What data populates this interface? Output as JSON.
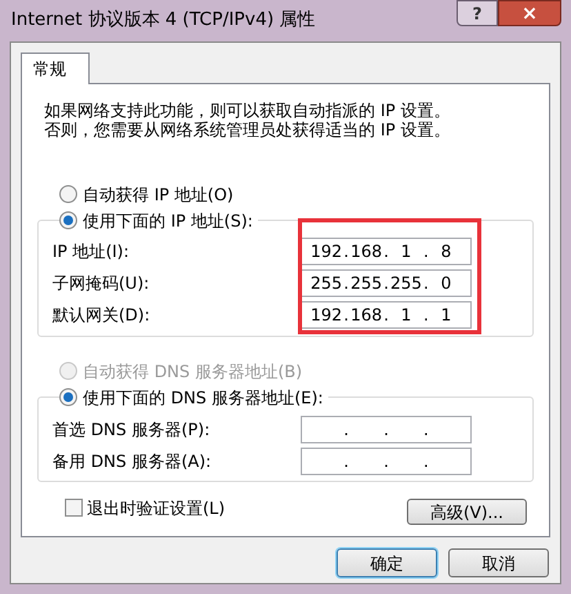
{
  "window": {
    "title": "Internet 协议版本 4 (TCP/IPv4) 属性",
    "help": "?",
    "close": "×"
  },
  "tabs": [
    {
      "label": "常规",
      "selected": true
    }
  ],
  "intro": "如果网络支持此功能，则可以获取自动指派的 IP 设置。否则，您需要从网络系统管理员处获得适当的 IP 设置。",
  "ip_mode": [
    {
      "label": "自动获得 IP 地址(O)",
      "selected": false,
      "disabled": false
    },
    {
      "label": "使用下面的 IP 地址(S):",
      "selected": true,
      "disabled": false
    }
  ],
  "ip_fields_highlighted": true,
  "ip_fields": [
    {
      "label": "IP 地址(I):",
      "separator": ".",
      "octets": [
        "192",
        "168",
        "1",
        "8"
      ]
    },
    {
      "label": "子网掩码(U):",
      "separator": ".",
      "octets": [
        "255",
        "255",
        "255",
        "0"
      ]
    },
    {
      "label": "默认网关(D):",
      "separator": ".",
      "octets": [
        "192",
        "168",
        "1",
        "1"
      ]
    }
  ],
  "dns_mode": [
    {
      "label": "自动获得 DNS 服务器地址(B)",
      "selected": false,
      "disabled": true
    },
    {
      "label": "使用下面的 DNS 服务器地址(E):",
      "selected": true,
      "disabled": false
    }
  ],
  "dns_fields": [
    {
      "label": "首选 DNS 服务器(P):",
      "separator": "."
    },
    {
      "label": "备用 DNS 服务器(A):",
      "separator": "."
    }
  ],
  "validate": {
    "label": "退出时验证设置(L)",
    "checked": false
  },
  "advanced_button": "高级(V)...",
  "buttons": [
    {
      "label": "确定",
      "default": true
    },
    {
      "label": "取消",
      "default": false
    }
  ]
}
